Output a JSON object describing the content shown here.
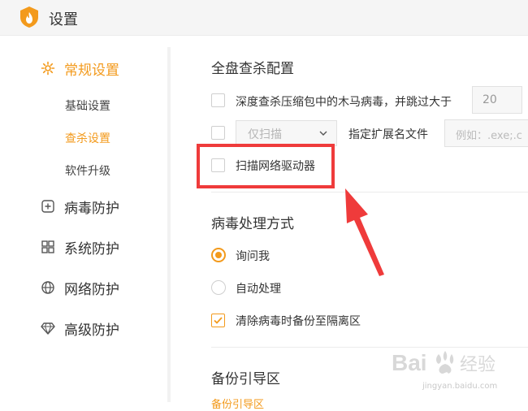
{
  "window": {
    "title": "设置"
  },
  "sidebar": {
    "items": [
      {
        "label": "常规设置",
        "icon": "gear-icon",
        "active": true
      },
      {
        "label": "病毒防护",
        "icon": "plus-square-icon",
        "active": false
      },
      {
        "label": "系统防护",
        "icon": "blocks-icon",
        "active": false
      },
      {
        "label": "网络防护",
        "icon": "globe-icon",
        "active": false
      },
      {
        "label": "高级防护",
        "icon": "diamond-icon",
        "active": false
      }
    ],
    "sub_items": [
      {
        "label": "基础设置",
        "active": false
      },
      {
        "label": "查杀设置",
        "active": true
      },
      {
        "label": "软件升级",
        "active": false
      }
    ]
  },
  "full_scan": {
    "title": "全盘查杀配置",
    "deep_scan": {
      "label": "深度查杀压缩包中的木马病毒，并跳过大于",
      "checked": false,
      "size_value": "20"
    },
    "scan_only": {
      "checked": false,
      "select_value": "仅扫描",
      "ext_label": "指定扩展名文件",
      "ext_placeholder": "例如：.exe;.c"
    },
    "network_drive": {
      "label": "扫描网络驱动器",
      "checked": false
    }
  },
  "virus_handling": {
    "title": "病毒处理方式",
    "options": [
      {
        "label": "询问我",
        "selected": true
      },
      {
        "label": "自动处理",
        "selected": false
      }
    ],
    "backup": {
      "label": "清除病毒时备份至隔离区",
      "checked": true
    }
  },
  "boot_sector": {
    "title": "备份引导区",
    "partial_label": "备份引导区"
  },
  "watermark": {
    "brand": "Bai 经验",
    "url": "jingyan.baidu.com"
  },
  "colors": {
    "accent": "#f39a1c",
    "highlight": "#ef3b3b"
  }
}
